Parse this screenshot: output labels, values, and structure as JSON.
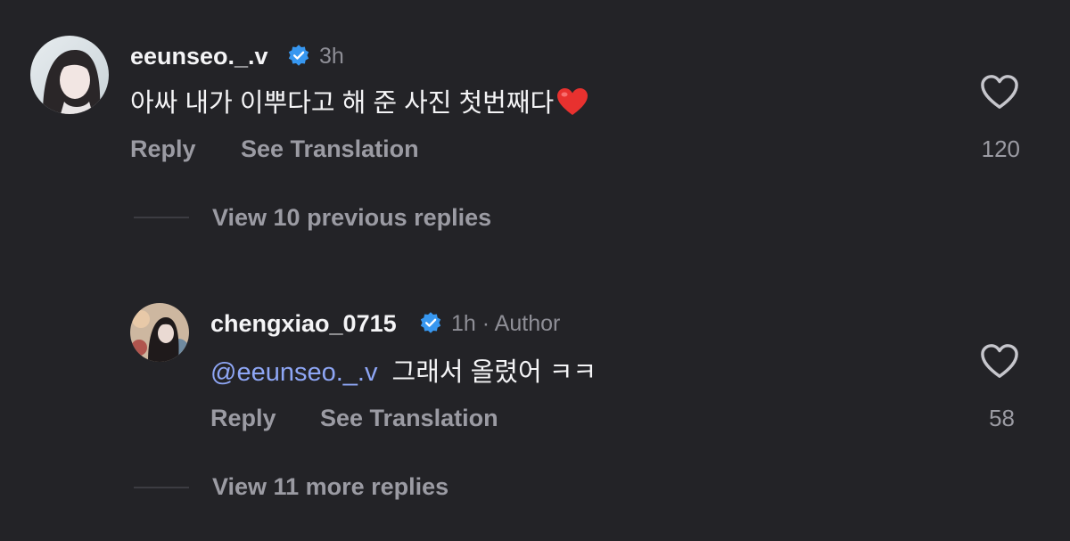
{
  "comment": {
    "username": "eeunseo._.v",
    "time": "3h",
    "text": "아싸 내가 이뿌다고 해 준 사진 첫번째다",
    "emoji_name": "red-heart-emoji",
    "reply_label": "Reply",
    "translate_label": "See Translation",
    "like_count": "120"
  },
  "view_previous": {
    "label": "View 10 previous replies"
  },
  "reply": {
    "username": "chengxiao_0715",
    "time": "1h",
    "separator": "·",
    "author_badge": "Author",
    "mention": "@eeunseo._.v",
    "text": "그래서 올렸어 ㅋㅋ",
    "reply_label": "Reply",
    "translate_label": "See Translation",
    "like_count": "58"
  },
  "view_more": {
    "label": "View 11 more replies"
  },
  "colors": {
    "background": "#232327",
    "verified_badge": "#3797f0",
    "mention": "#8ea6f5",
    "secondary_text": "#9b9ba3"
  }
}
